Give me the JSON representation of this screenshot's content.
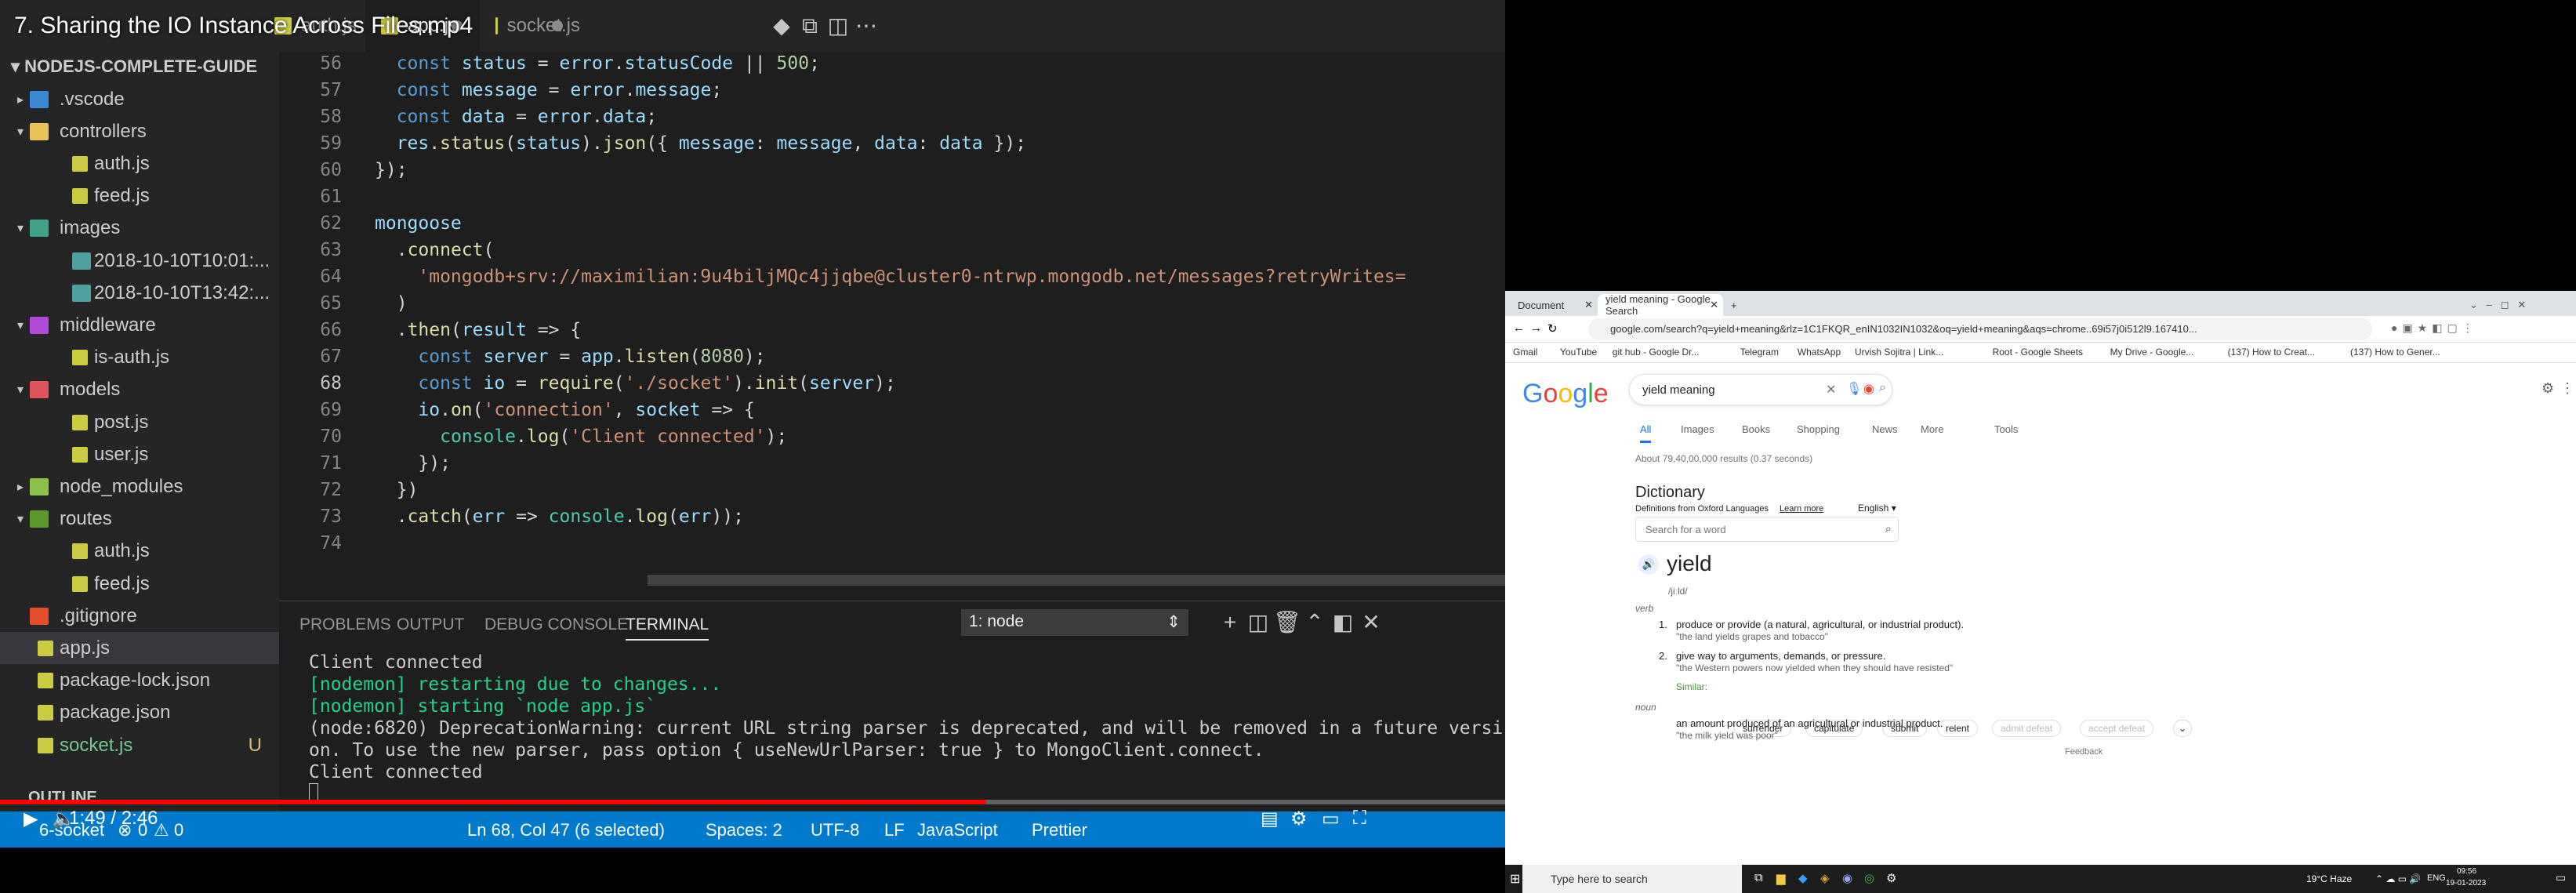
{
  "video": {
    "title": "7. Sharing the IO Instance Across Files.mp4",
    "time": "1:49 / 2:46",
    "progress": 0.655
  },
  "editor_tabs": [
    {
      "label": "auth.js",
      "active": false,
      "modified": false
    },
    {
      "label": "app.js",
      "active": true,
      "modified": true
    },
    {
      "label": "socket.js",
      "active": false,
      "modified": true
    }
  ],
  "sidebar": {
    "title": "NODEJS-COMPLETE-GUIDE",
    "items": [
      {
        "label": ".vscode",
        "type": "folder",
        "depth": 0,
        "open": false
      },
      {
        "label": "controllers",
        "type": "folder",
        "depth": 0,
        "open": true
      },
      {
        "label": "auth.js",
        "type": "js",
        "depth": 1
      },
      {
        "label": "feed.js",
        "type": "js",
        "depth": 1
      },
      {
        "label": "images",
        "type": "folder",
        "depth": 0,
        "open": true
      },
      {
        "label": "2018-10-10T10:01:...",
        "type": "img",
        "depth": 1
      },
      {
        "label": "2018-10-10T13:42:...",
        "type": "img",
        "depth": 1
      },
      {
        "label": "middleware",
        "type": "folder",
        "depth": 0,
        "open": true
      },
      {
        "label": "is-auth.js",
        "type": "js",
        "depth": 1
      },
      {
        "label": "models",
        "type": "folder",
        "depth": 0,
        "open": true
      },
      {
        "label": "post.js",
        "type": "js",
        "depth": 1
      },
      {
        "label": "user.js",
        "type": "js",
        "depth": 1
      },
      {
        "label": "node_modules",
        "type": "folder",
        "depth": 0,
        "open": false
      },
      {
        "label": "routes",
        "type": "folder",
        "depth": 0,
        "open": true
      },
      {
        "label": "auth.js",
        "type": "js",
        "depth": 1
      },
      {
        "label": "feed.js",
        "type": "js",
        "depth": 1
      },
      {
        "label": ".gitignore",
        "type": "git",
        "depth": 0
      },
      {
        "label": "app.js",
        "type": "js",
        "depth": 0,
        "selected": true
      },
      {
        "label": "package-lock.json",
        "type": "json",
        "depth": 0
      },
      {
        "label": "package.json",
        "type": "json",
        "depth": 0
      },
      {
        "label": "socket.js",
        "type": "js",
        "depth": 0,
        "badge": "U"
      }
    ],
    "outline": "OUTLINE"
  },
  "code": {
    "line_numbers": [
      "56",
      "57",
      "58",
      "59",
      "60",
      "61",
      "62",
      "63",
      "64",
      "65",
      "66",
      "67",
      "68",
      "69",
      "70",
      "71",
      "72",
      "73",
      "74"
    ],
    "current_line": "68",
    "lines": [
      "  const status = error.statusCode || 500;",
      "  const message = error.message;",
      "  const data = error.data;",
      "  res.status(status).json({ message: message, data: data });",
      "});",
      "",
      "mongoose",
      "  .connect(",
      "    'mongodb+srv://maximilian:9u4biljMQc4jjqbe@cluster0-ntrwp.mongodb.net/messages?retryWrites=",
      "  )",
      "  .then(result => {",
      "    const server = app.listen(8080);",
      "    const io = require('./socket').init(server);",
      "    io.on('connection', socket => {",
      "      console.log('Client connected');",
      "    });",
      "  })",
      "  .catch(err => console.log(err));",
      ""
    ]
  },
  "panel": {
    "tabs": [
      "PROBLEMS",
      "OUTPUT",
      "DEBUG CONSOLE",
      "TERMINAL"
    ],
    "active_tab": "TERMINAL",
    "terminal_select": "1: node",
    "terminal_lines": [
      "Client connected",
      "[nodemon] restarting due to changes...",
      "[nodemon] starting `node app.js`",
      "(node:6820) DeprecationWarning: current URL string parser is deprecated, and will be removed in a future versi",
      "on. To use the new parser, pass option { useNewUrlParser: true } to MongoClient.connect.",
      "Client connected"
    ]
  },
  "statusbar": {
    "branch": "6-socket",
    "errors": "0",
    "warnings": "0",
    "position": "Ln 68, Col 47 (6 selected)",
    "spaces": "Spaces: 2",
    "encoding": "UTF-8",
    "eol": "LF",
    "language": "JavaScript",
    "prettier": "Prettier"
  },
  "chrome": {
    "tabs": [
      {
        "label": "Document"
      },
      {
        "label": "yield meaning - Google Search"
      }
    ],
    "url": "google.com/search?q=yield+meaning&rlz=1C1FKQR_enIN1032IN1032&oq=yield+meaning&aqs=chrome..69i57j0i512l9.167410...",
    "bookmarks": [
      "Gmail",
      "YouTube",
      "git hub - Google Dr...",
      "Telegram",
      "WhatsApp",
      "Urvish Sojitra | Link...",
      "Root - Google Sheets",
      "My Drive - Google...",
      "(137) How to Creat...",
      "(137) How to Gener..."
    ],
    "search": {
      "query": "yield meaning",
      "nav": [
        "All",
        "Images",
        "Books",
        "Shopping",
        "News",
        "More"
      ],
      "tools": "Tools",
      "results": "About 79,40,00,000 results (0.37 seconds)"
    },
    "dictionary": {
      "heading": "Dictionary",
      "source": "Definitions from Oxford Languages",
      "learn_more": "Learn more",
      "language": "English",
      "search_placeholder": "Search for a word",
      "word": "yield",
      "pron": "/jiːld/",
      "pos_verb": "verb",
      "defs": [
        {
          "n": "1.",
          "text": "produce or provide (a natural, agricultural, or industrial product).",
          "example": "\"the land yields grapes and tobacco\""
        },
        {
          "n": "2.",
          "text": "give way to arguments, demands, or pressure.",
          "example": "\"the Western powers now yielded when they should have resisted\""
        }
      ],
      "similar_label": "Similar:",
      "similar": [
        "surrender",
        "capitulate",
        "submit",
        "relent",
        "admit defeat",
        "accept defeat"
      ],
      "pos_noun": "noun",
      "noun_def": "an amount produced of an agricultural or industrial product.",
      "noun_example": "\"the milk yield was poor\"",
      "feedback": "Feedback"
    },
    "taskbar": {
      "search": "Type here to search",
      "weather": "19°C Haze",
      "lang": "ENG",
      "time": "09:56",
      "date": "19-01-2023"
    }
  }
}
